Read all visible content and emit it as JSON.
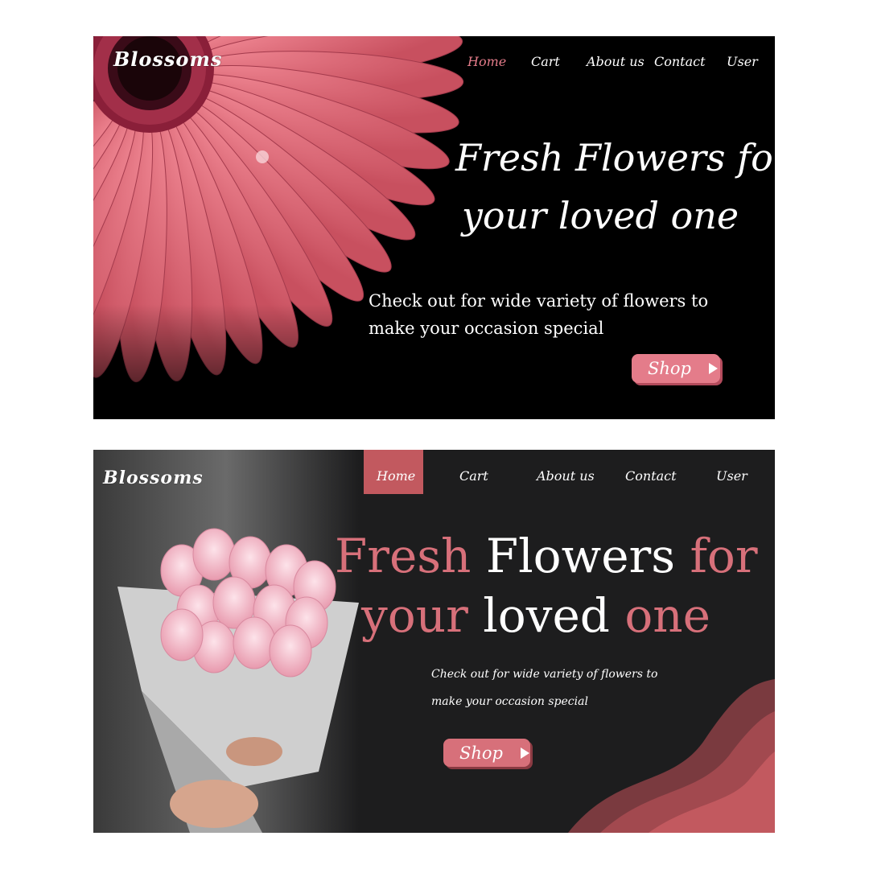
{
  "panel1": {
    "logo": "Blossoms",
    "nav": [
      "Home",
      "Cart",
      "About us",
      "Contact",
      "User"
    ],
    "title_line1": {
      "w1": "Fresh",
      "w2": "Flowers",
      "w3": "for"
    },
    "title_line2": {
      "w1": "your",
      "w2": "loved",
      "w3": "one"
    },
    "subtitle_line1": "Check out for wide variety of flowers to",
    "subtitle_line2": "make your occasion special",
    "shop_label": "Shop"
  },
  "panel2": {
    "logo": "Blossoms",
    "nav": [
      "Home",
      "Cart",
      "About us",
      "Contact",
      "User"
    ],
    "title_line1": {
      "w1": "Fresh",
      "w2": "Flowers",
      "w3": "for"
    },
    "title_line2": {
      "w1": "your",
      "w2": "loved",
      "w3": "one"
    },
    "subtitle_line1": "Check out for wide variety of flowers to",
    "subtitle_line2": "make your occasion special",
    "shop_label": "Shop"
  },
  "colors": {
    "accent_pink": "#e47c8a",
    "accent_rose": "#c2595f",
    "dark_bg": "#1d1d1e"
  }
}
